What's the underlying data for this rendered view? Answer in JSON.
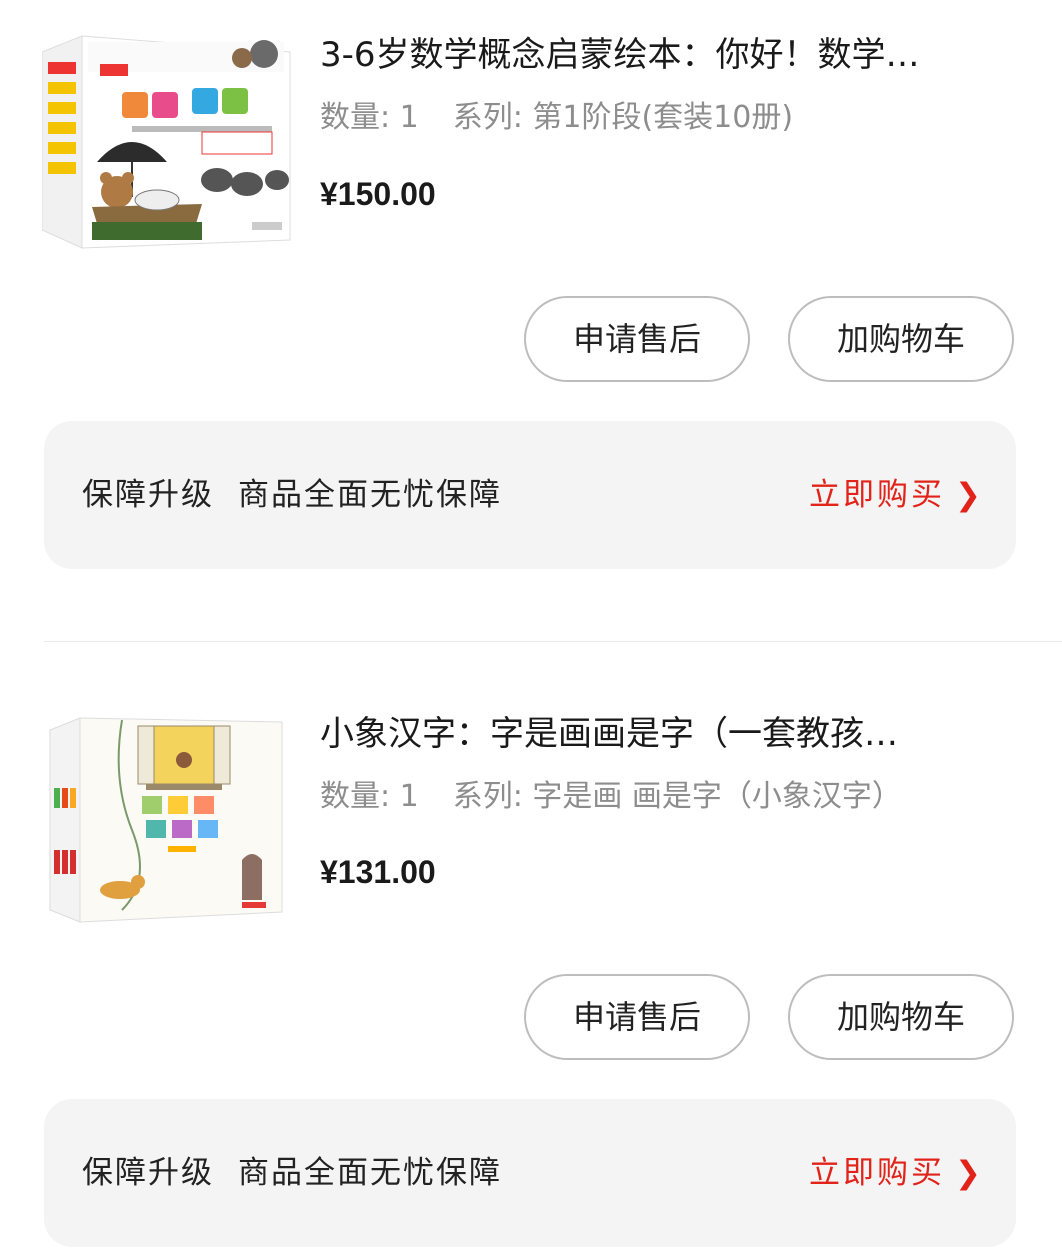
{
  "orders": [
    {
      "image_alt": "你好！数学",
      "title": "3-6岁数学概念启蒙绘本：你好！数学…",
      "quantity_label": "数量: 1",
      "series_label": "系列: 第1阶段(套装10册)",
      "price": "¥150.00",
      "actions": {
        "after_sale": "申请售后",
        "add_cart": "加购物车"
      },
      "guarantee": {
        "label_1": "保障升级",
        "label_2": "商品全面无忧保障",
        "buy_now": "立即购买",
        "chevron": "❯"
      }
    },
    {
      "image_alt": "字是画 画是字",
      "title": "小象汉字：字是画画是字（一套教孩…",
      "quantity_label": "数量: 1",
      "series_label": "系列: 字是画 画是字（小象汉字）",
      "price": "¥131.00",
      "actions": {
        "after_sale": "申请售后",
        "add_cart": "加购物车"
      },
      "guarantee": {
        "label_1": "保障升级",
        "label_2": "商品全面无忧保障",
        "buy_now": "立即购买",
        "chevron": "❯"
      }
    }
  ],
  "colors": {
    "accent_red": "#e2231a",
    "price_text": "#1a1a1a",
    "meta_text": "#8d8d8d",
    "guarantee_bg": "#f4f4f4"
  }
}
